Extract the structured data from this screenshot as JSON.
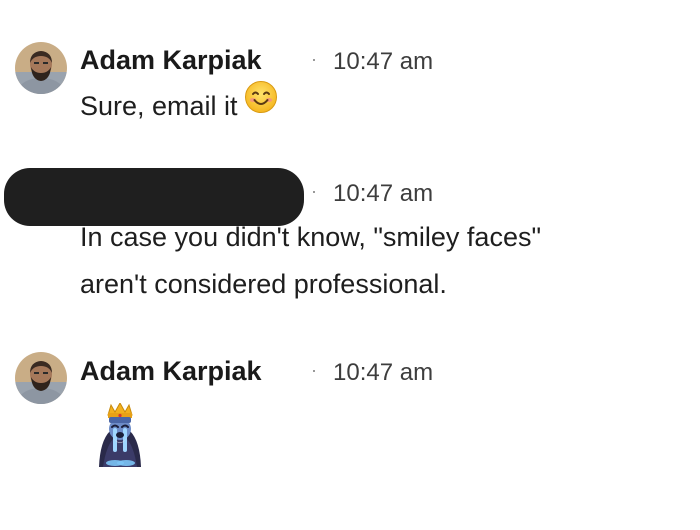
{
  "messages": [
    {
      "author": "Adam Karpiak",
      "separator": "·",
      "time": "10:47 am",
      "text": "Sure, email it",
      "attached_emoji": "smiling-face-emoji"
    },
    {
      "author_redacted": true,
      "separator": "·",
      "time": "10:47 am",
      "lines": [
        "In case you didn't know, \"smiley faces\"",
        "aren't considered professional."
      ]
    },
    {
      "author": "Adam Karpiak",
      "separator": "·",
      "time": "10:47 am",
      "emoji": "crowned-crying-king-emoji"
    }
  ],
  "colors": {
    "text": "#1e1e1e",
    "meta": "#3d3d3d",
    "redaction": "#1f1f1f",
    "background": "#ffffff"
  }
}
